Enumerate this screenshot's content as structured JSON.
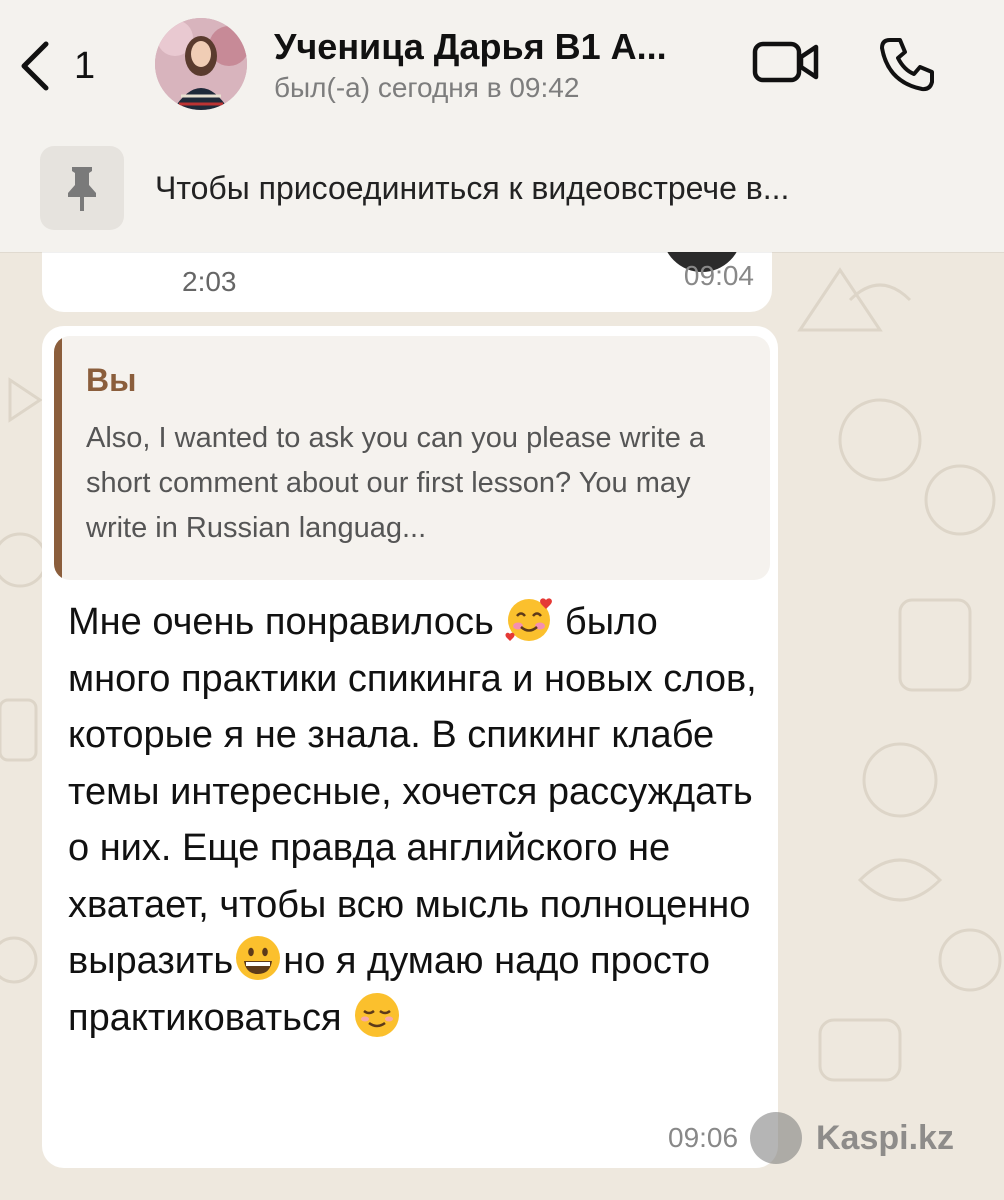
{
  "header": {
    "back_count": "1",
    "contact_name": "Ученица Дарья В1 А...",
    "contact_status": "был(-а) сегодня в 09:42",
    "icons": {
      "back": "chevron-left-icon",
      "video": "video-camera-icon",
      "phone": "phone-icon"
    }
  },
  "pinned": {
    "icon": "pin-icon",
    "text": "Чтобы присоединиться к видеовстрече в..."
  },
  "previous_message": {
    "duration": "2:03",
    "time": "09:04"
  },
  "message": {
    "quote_author": "Вы",
    "quote_text": "Also, I wanted to ask you can you please write a short comment about our first lesson? You may write in Russian languag...",
    "text_part1": "Мне очень понравилось ",
    "emoji1": "smiling-face-with-hearts",
    "text_part2": " было много практики спикинга и новых слов, которые я не знала. В спикинг клабе темы интересные, хочется рассуждать о них. Еще правда английского не хватает, чтобы всю мысль полноценно выразить",
    "emoji2": "grinning-face",
    "text_part3": "но я думаю надо просто практиковаться ",
    "emoji3": "relieved-face",
    "time": "09:06"
  },
  "watermark": {
    "text": "Kaspi.kz"
  },
  "colors": {
    "quote_accent": "#8b5e3c",
    "header_bg": "#f4f2ee",
    "wallpaper": "#eee8de",
    "bubble": "#ffffff"
  }
}
